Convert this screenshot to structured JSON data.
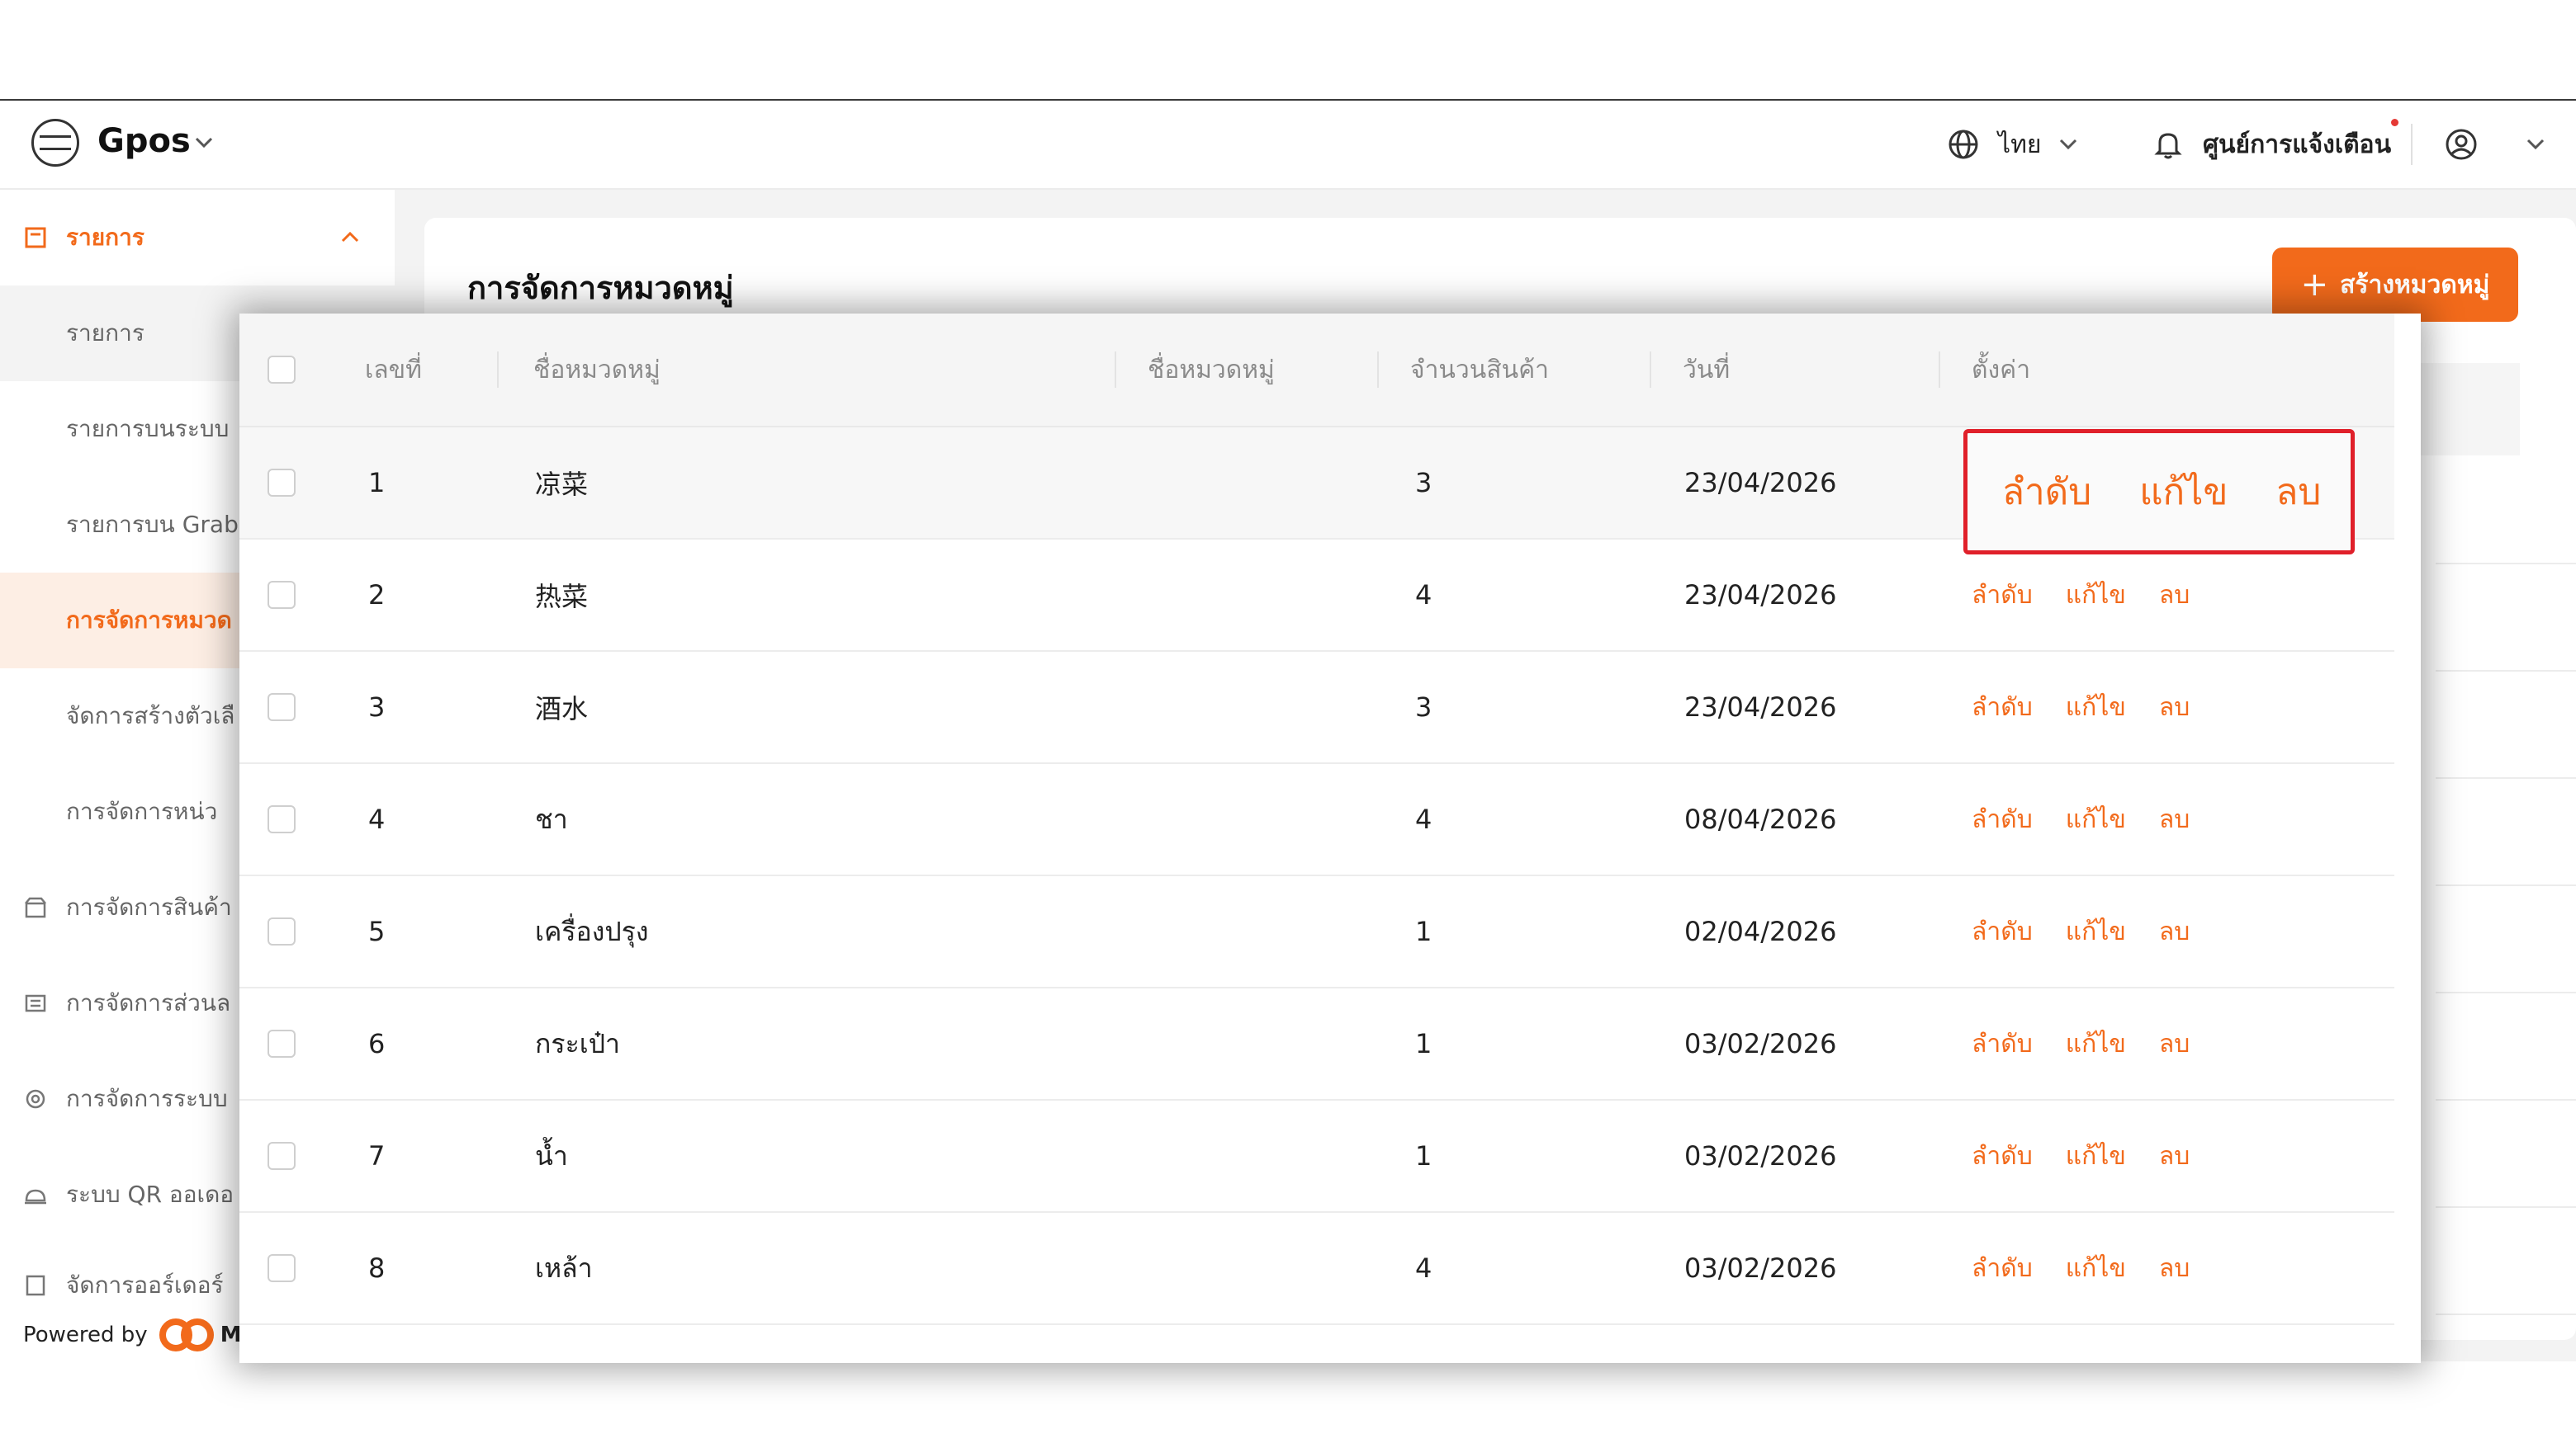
{
  "header": {
    "brand": "Gpos",
    "language": "ไทย",
    "notifications_label": "ศูนย์การแจ้งเตือน"
  },
  "sidebar": {
    "items": [
      {
        "label": "รายการ"
      },
      {
        "label": "รายการ"
      },
      {
        "label": "รายการบนระบบ"
      },
      {
        "label": "รายการบน Grab"
      },
      {
        "label": "การจัดการหมวด"
      },
      {
        "label": "จัดการสร้างตัวเลื"
      },
      {
        "label": "การจัดการหน่ว"
      },
      {
        "label": "การจัดการสินค้า"
      },
      {
        "label": "การจัดการส่วนล"
      },
      {
        "label": "การจัดการระบบ"
      },
      {
        "label": "ระบบ QR ออเดอ"
      },
      {
        "label": "จัดการออร์เดอร์"
      }
    ],
    "powered_by": "Powered by",
    "powered_brand": "Ma"
  },
  "main": {
    "title": "การจัดการหมวดหมู่",
    "create_button": "สร้างหมวดหมู่"
  },
  "table": {
    "columns": [
      "เลขที่",
      "ชื่อหมวดหมู่",
      "ชื่อหมวดหมู่",
      "จำนวนสินค้า",
      "วันที่",
      "ตั้งค่า"
    ],
    "actions": {
      "order": "ลำดับ",
      "edit": "แก้ไข",
      "delete": "ลบ"
    },
    "rows": [
      {
        "no": "1",
        "name": "凉菜",
        "count": "3",
        "date": "23/04/2026"
      },
      {
        "no": "2",
        "name": "热菜",
        "count": "4",
        "date": "23/04/2026"
      },
      {
        "no": "3",
        "name": "酒水",
        "count": "3",
        "date": "23/04/2026"
      },
      {
        "no": "4",
        "name": "ชา",
        "count": "4",
        "date": "08/04/2026"
      },
      {
        "no": "5",
        "name": "เครื่องปรุง",
        "count": "1",
        "date": "02/04/2026"
      },
      {
        "no": "6",
        "name": "กระเป๋า",
        "count": "1",
        "date": "03/02/2026"
      },
      {
        "no": "7",
        "name": "น้ำ",
        "count": "1",
        "date": "03/02/2026"
      },
      {
        "no": "8",
        "name": "เหล้า",
        "count": "4",
        "date": "03/02/2026"
      }
    ]
  },
  "colors": {
    "accent": "#f26a1b",
    "highlight": "#e0202a"
  }
}
